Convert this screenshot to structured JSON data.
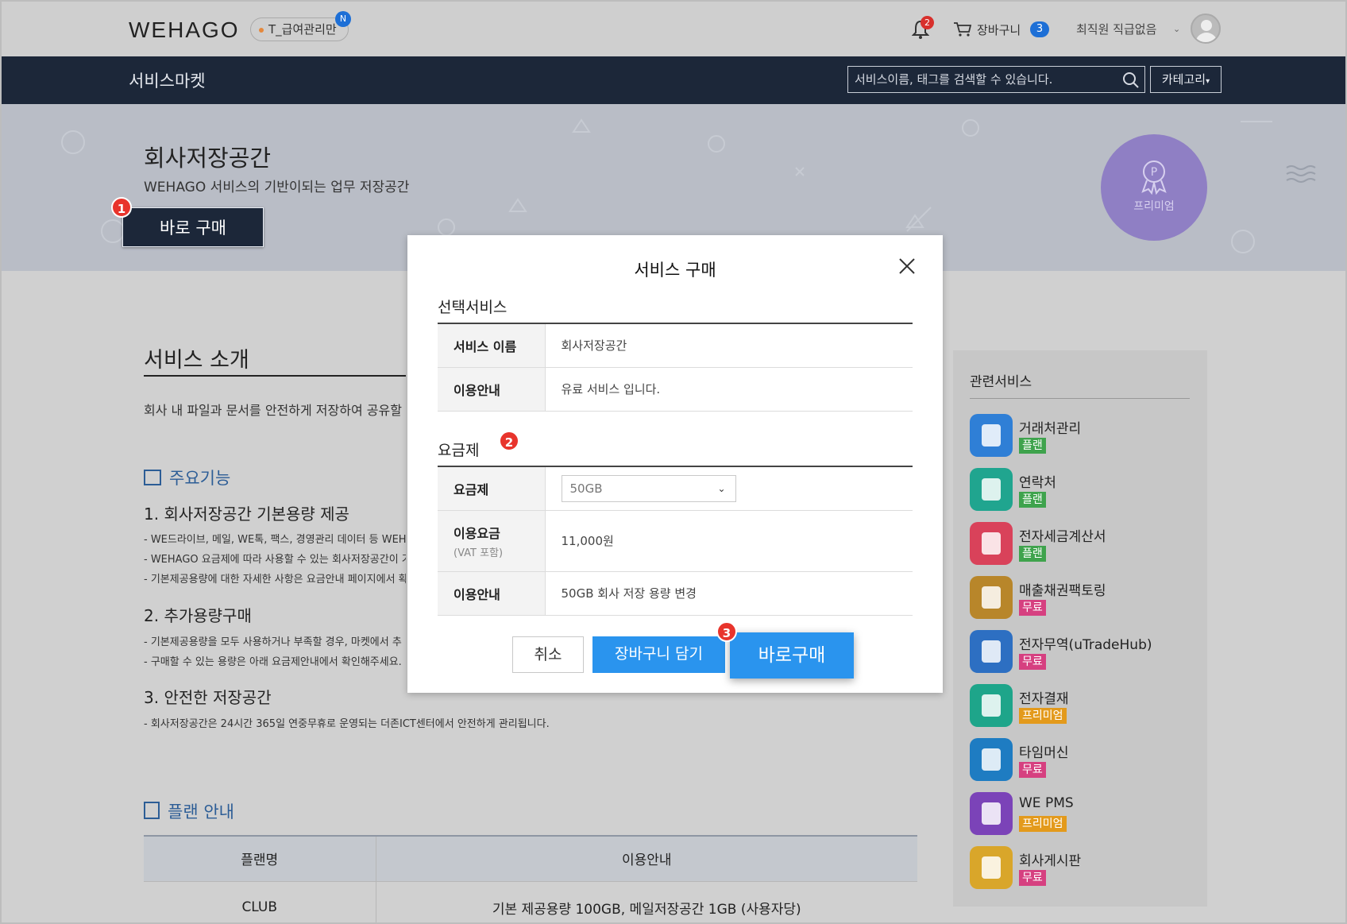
{
  "header": {
    "logo": "WEHAGO",
    "company": "T_급여관리만",
    "company_badge": "N",
    "notification_count": "2",
    "cart_label": "장바구니",
    "cart_count": "3",
    "user_name": "최직원 직급없음"
  },
  "nav": {
    "title": "서비스마켓",
    "search_placeholder": "서비스이름, 태그를 검색할 수 있습니다.",
    "category_label": "카테고리"
  },
  "hero": {
    "title": "회사저장공간",
    "subtitle": "WEHAGO 서비스의 기반이되는 업무 저장공간",
    "buy_button": "바로 구매",
    "badge_label": "프리미엄"
  },
  "markers": [
    "1",
    "2",
    "3"
  ],
  "intro": {
    "title": "서비스 소개",
    "description": "회사 내 파일과 문서를 안전하게 저장하여 공유할 수",
    "features_heading": "주요기능",
    "features": [
      {
        "title": "1. 회사저장공간 기본용량 제공",
        "lines": [
          "- WE드라이브, 메일, WE톡, 팩스, 경영관리 데이터 등 WEHA",
          "- WEHAGO 요금제에 따라 사용할 수 있는 회사저장공간이 기",
          "- 기본제공용량에 대한 자세한 사항은 요금안내 페이지에서 확"
        ]
      },
      {
        "title": "2. 추가용량구매",
        "lines": [
          "- 기본제공용량을 모두 사용하거나 부족할 경우, 마켓에서 추",
          "- 구매할 수 있는 용량은 아래 요금제안내에서 확인해주세요."
        ]
      },
      {
        "title": "3. 안전한 저장공간",
        "lines": [
          "- 회사저장공간은 24시간 365일 연중무휴로 운영되는 더존ICT센터에서 안전하게 관리됩니다."
        ]
      }
    ],
    "plan_heading": "플랜 안내",
    "plan_table": {
      "headers": [
        "플랜명",
        "이용안내"
      ],
      "rows": [
        [
          "CLUB",
          "기본 제공용량 100GB, 메일저장공간 1GB (사용자당)"
        ]
      ]
    }
  },
  "related": {
    "title": "관련서비스",
    "items": [
      {
        "name": "거래처관리",
        "tag": "플랜",
        "tag_color": "#3fa34d",
        "icon_color": "#2f7fd6"
      },
      {
        "name": "연락처",
        "tag": "플랜",
        "tag_color": "#3fa34d",
        "icon_color": "#20a58f"
      },
      {
        "name": "전자세금계산서",
        "tag": "플랜",
        "tag_color": "#3fa34d",
        "icon_color": "#d9425a"
      },
      {
        "name": "매출채권팩토링",
        "tag": "무료",
        "tag_color": "#d64080",
        "icon_color": "#b8862a"
      },
      {
        "name": "전자무역(uTradeHub)",
        "tag": "무료",
        "tag_color": "#d64080",
        "icon_color": "#2d6fc2"
      },
      {
        "name": "전자결재",
        "tag": "프리미엄",
        "tag_color": "#e39a1c",
        "icon_color": "#1ea58a"
      },
      {
        "name": "타임머신",
        "tag": "무료",
        "tag_color": "#d64080",
        "icon_color": "#1e7cc2"
      },
      {
        "name": "WE PMS",
        "tag": "프리미엄",
        "tag_color": "#e39a1c",
        "icon_color": "#7b43b8"
      },
      {
        "name": "회사게시판",
        "tag": "무료",
        "tag_color": "#d64080",
        "icon_color": "#d9a62a"
      }
    ]
  },
  "modal": {
    "title": "서비스 구매",
    "selected_heading": "선택서비스",
    "service_name_label": "서비스 이름",
    "service_name_value": "회사저장공간",
    "usage_label": "이용안내",
    "usage_value": "유료 서비스 입니다.",
    "plan_heading": "요금제",
    "plan_label": "요금제",
    "plan_selected": "50GB",
    "fee_label": "이용요금",
    "fee_sub": "(VAT 포함)",
    "fee_value": "11,000원",
    "plan_usage_label": "이용안내",
    "plan_usage_value": "50GB 회사 저장 용량 변경",
    "cancel_label": "취소",
    "cart_label": "장바구니 담기",
    "buy_label": "바로구매"
  }
}
